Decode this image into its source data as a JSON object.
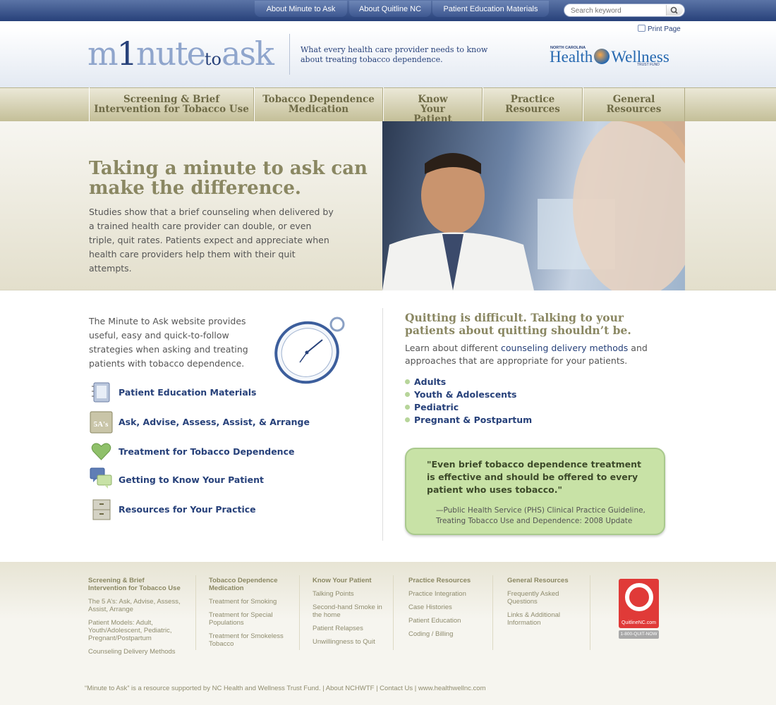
{
  "topnav": {
    "items": [
      "About Minute to Ask",
      "About Quitline NC",
      "Patient Education Materials"
    ],
    "search_placeholder": "Search keyword"
  },
  "header": {
    "logo_parts": {
      "a": "m",
      "b": "1",
      "c": "nute",
      "d": "to",
      "e": "ask"
    },
    "tagline": "What every health care provider needs to know about treating tobacco dependence.",
    "print_label": "Print Page",
    "partner": {
      "small": "NORTH CAROLINA",
      "left": "Health",
      "right": "Wellness",
      "sub": "TRUST FUND"
    }
  },
  "nav": {
    "items": [
      "Screening & Brief Intervention for Tobacco Use",
      "Tobacco Dependence Medication",
      "Know Your Patient",
      "Practice Resources",
      "General Resources"
    ]
  },
  "hero": {
    "title": "Taking a minute to ask can make the difference.",
    "text": "Studies show that a brief counseling when delivered by a trained health care provider can double, or even triple, quit rates. Patients expect and appreciate when health care providers help them with their quit attempts."
  },
  "left": {
    "intro": "The Minute to Ask website provides useful, easy and quick-to-follow strategies when asking and treating patients with tobacco dependence.",
    "links": [
      "Patient Education Materials",
      "Ask, Advise, Assess, Assist, & Arrange",
      "Treatment for Tobacco Dependence",
      "Getting to Know Your Patient",
      "Resources for Your Practice"
    ],
    "fiveas_badge": "5A's"
  },
  "right": {
    "title": "Quitting is difficult. Talking to your patients about quitting shouldn’t be.",
    "text_before": "Learn about different ",
    "text_link": "counseling delivery methods",
    "text_after": " and approaches that are appropriate for your patients.",
    "bullets": [
      "Adults",
      "Youth & Adolescents",
      "Pediatric",
      "Pregnant & Postpartum"
    ],
    "quote": "\"Even brief tobacco dependence treatment is effective and should be offered to every patient who uses tobacco.\"",
    "quote_source": "—Public Health Service (PHS) Clinical Practice Guideline, Treating Tobacco Use and Dependence: 2008 Update"
  },
  "footer": {
    "columns": [
      {
        "heading": "Screening & Brief Intervention for Tobacco Use",
        "links": [
          "The 5 A’s: Ask, Advise, Assess, Assist, Arrange",
          "Patient Models: Adult, Youth/Adolescent, Pediatric, Pregnant/Postpartum",
          "Counseling Delivery Methods"
        ]
      },
      {
        "heading": "Tobacco Dependence Medication",
        "links": [
          "Treatment for Smoking",
          "Treatment for Special Populations",
          "Treatment for Smokeless Tobacco"
        ]
      },
      {
        "heading": "Know Your Patient",
        "links": [
          "Talking Points",
          "Second-hand Smoke in the home",
          "Patient Relapses",
          "Unwillingness to Quit"
        ]
      },
      {
        "heading": "Practice Resources",
        "links": [
          "Practice Integration",
          "Case Histories",
          "Patient Education",
          "Coding / Billing"
        ]
      },
      {
        "heading": "General Resources",
        "links": [
          "Frequently Asked Questions",
          "Links & Additional Information"
        ]
      }
    ],
    "quitline_text": "QuitlineNC.com",
    "quitline_phone": "1-800-QUIT-NOW",
    "copyright": "“Minute to Ask” is a resource supported by NC Health and Wellness Trust Fund.  |  About NCHWTF  |  Contact Us  |  www.healthwellnc.com"
  },
  "colors": {
    "navy": "#27417a",
    "olive": "#8a8762",
    "green_box": "#c8e2a6",
    "quitline_red": "#e03a38"
  }
}
